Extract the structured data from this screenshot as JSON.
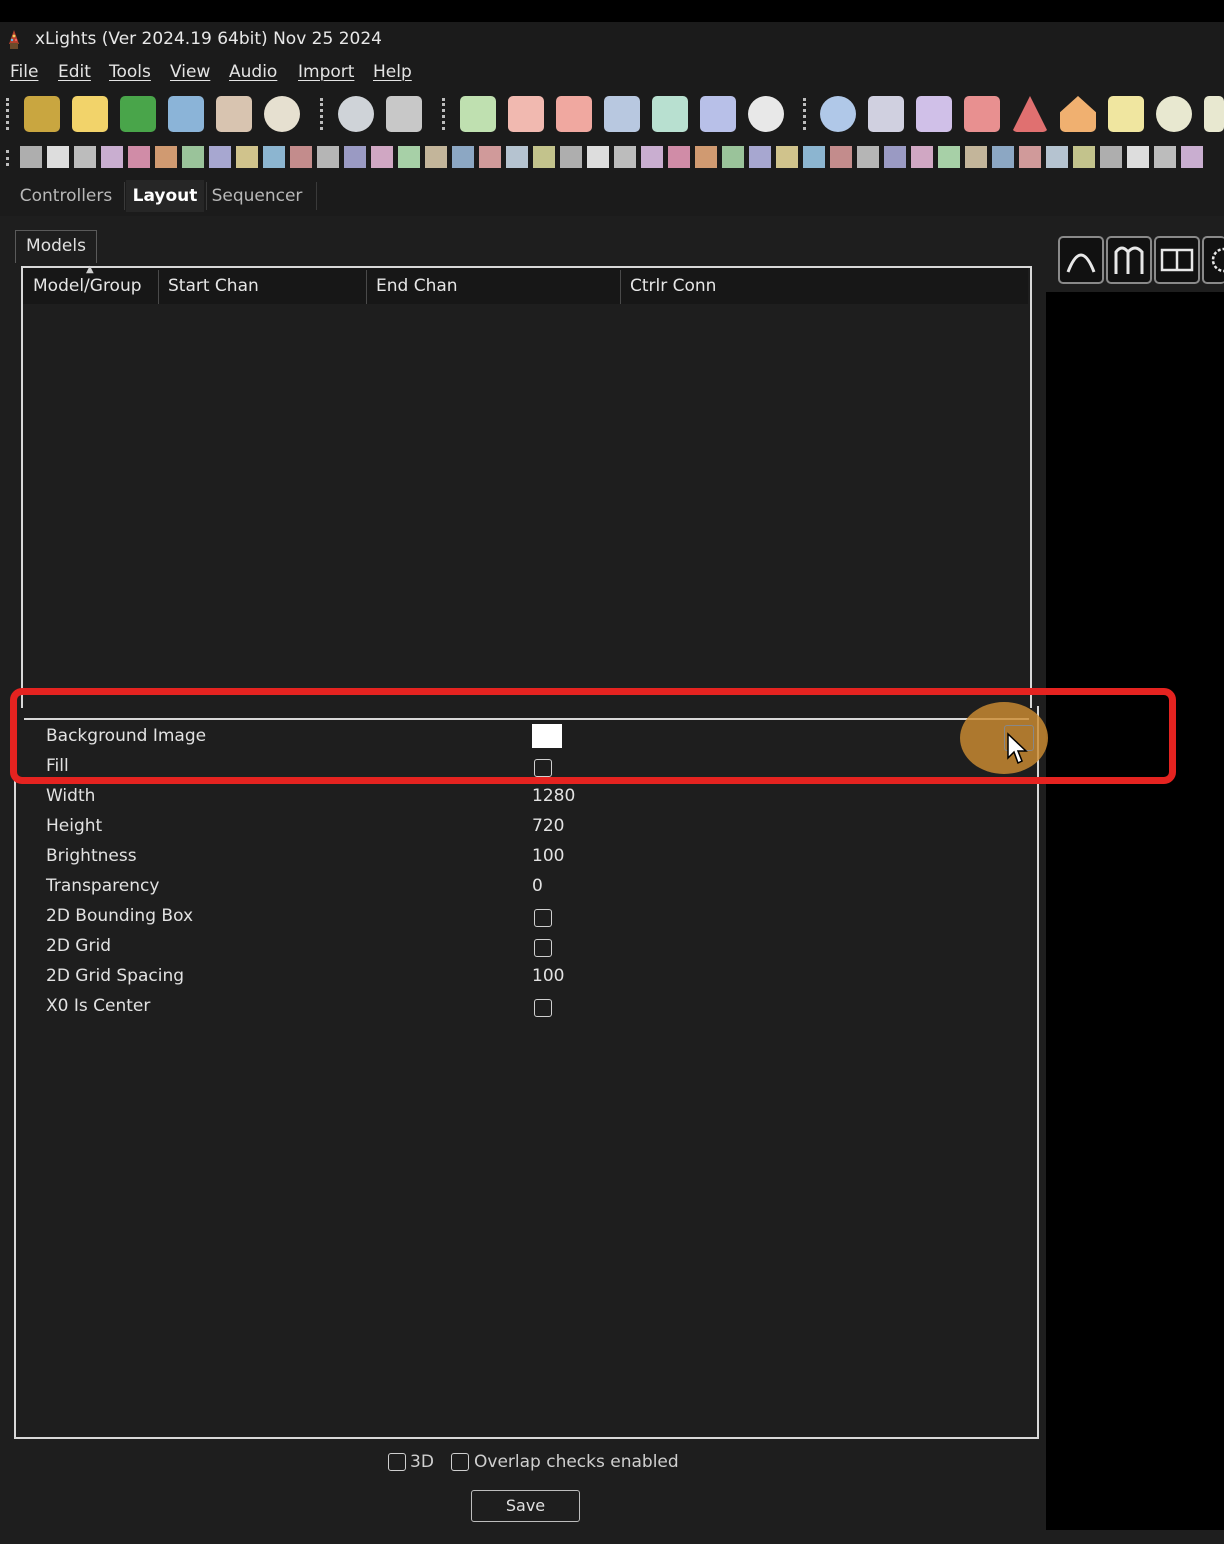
{
  "app": {
    "title": "xLights (Ver 2024.19 64bit) Nov 25 2024"
  },
  "menu": [
    "File",
    "Edit",
    "Tools",
    "View",
    "Audio",
    "Import",
    "Help"
  ],
  "toolbar": {
    "icons": [
      "new-sequence-icon",
      "new-file-icon",
      "open-folder-icon",
      "save-icon",
      "print-icon",
      "palette-icon",
      "clock-icon",
      "grid-icon",
      "play-icon",
      "pause-icon",
      "stop-icon",
      "rewind-icon",
      "fast-forward-icon",
      "repeat-icon",
      "bulb-icon",
      "settings-gear-icon",
      "effects-bars-icon",
      "layers-icon",
      "overlap-icon",
      "warning-triangle-icon",
      "house-icon",
      "model-icon",
      "starburst-icon"
    ]
  },
  "main_tabs": [
    {
      "label": "Controllers",
      "active": false
    },
    {
      "label": "Layout",
      "active": true
    },
    {
      "label": "Sequencer",
      "active": false
    }
  ],
  "models_panel": {
    "tab_label": "Models",
    "columns": [
      "Model/Group",
      "Start Chan",
      "End Chan",
      "Ctrlr Conn"
    ],
    "rows": []
  },
  "properties": [
    {
      "label": "Background Image",
      "type": "image",
      "value": ""
    },
    {
      "label": "Fill",
      "type": "checkbox",
      "checked": false
    },
    {
      "label": "Width",
      "type": "text",
      "value": "1280"
    },
    {
      "label": "Height",
      "type": "text",
      "value": "720"
    },
    {
      "label": "Brightness",
      "type": "text",
      "value": "100"
    },
    {
      "label": "Transparency",
      "type": "text",
      "value": "0"
    },
    {
      "label": "2D Bounding Box",
      "type": "checkbox",
      "checked": false
    },
    {
      "label": "2D Grid",
      "type": "checkbox",
      "checked": false
    },
    {
      "label": "2D Grid Spacing",
      "type": "text",
      "value": "100"
    },
    {
      "label": "X0 Is Center",
      "type": "checkbox",
      "checked": false
    }
  ],
  "bottom": {
    "checkbox_3d_label": "3D",
    "checkbox_3d_checked": false,
    "overlap_label": "Overlap checks enabled",
    "overlap_checked": false,
    "save_label": "Save"
  },
  "view_buttons": [
    "arc-icon",
    "arches-icon",
    "split-view-icon",
    "rotate-icon"
  ],
  "colors": {
    "highlight": "#e52320",
    "background": "#1e1e1e",
    "cursor_halo": "#cd8c32"
  }
}
